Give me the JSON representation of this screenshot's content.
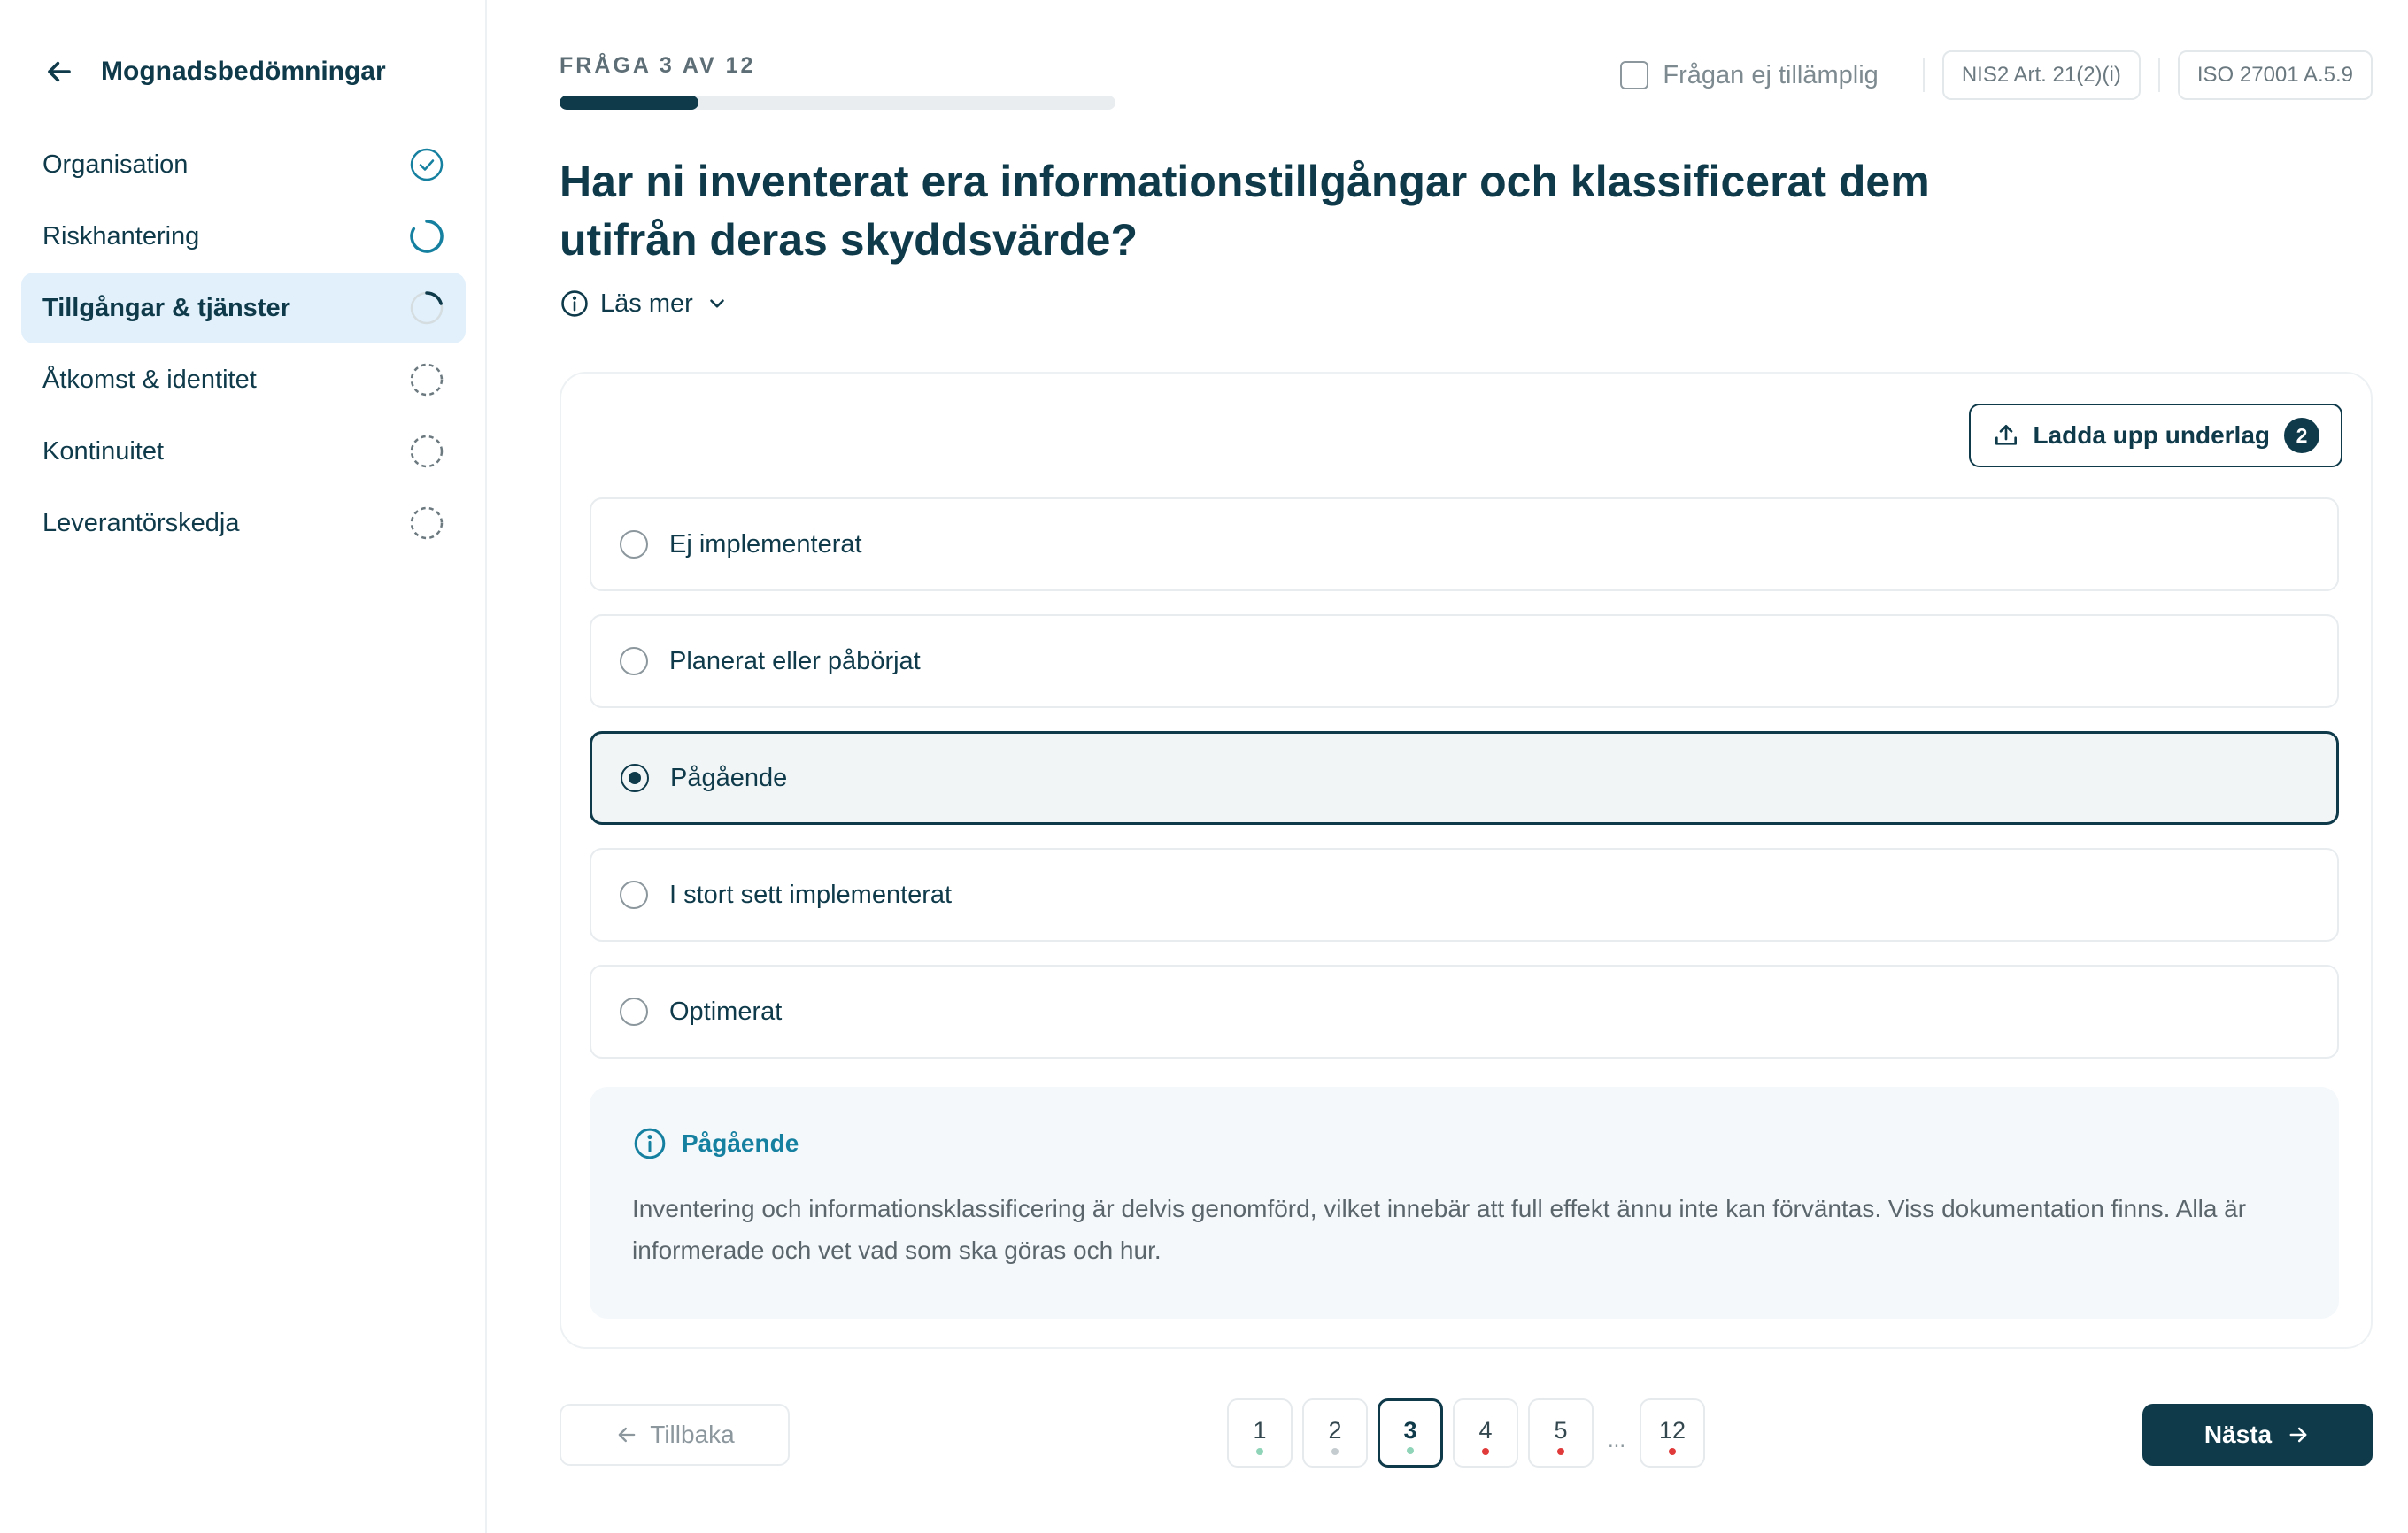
{
  "colors": {
    "primary": "#0e3a4a",
    "accent": "#1680a0",
    "active_bg": "#e1f0fb",
    "dot_done": "#8fd4b8",
    "dot_neutral": "#c5ccd0",
    "dot_missing": "#e03a3a"
  },
  "sidebar": {
    "back_icon": "arrow-left-icon",
    "title": "Mognadsbedömningar",
    "items": [
      {
        "label": "Organisation",
        "status": "complete",
        "icon": "check-circle-icon"
      },
      {
        "label": "Riskhantering",
        "status": "in-progress",
        "icon": "progress-ring-icon"
      },
      {
        "label": "Tillgångar & tjänster",
        "status": "started",
        "icon": "progress-ring-icon",
        "active": true
      },
      {
        "label": "Åtkomst & identitet",
        "status": "not-started",
        "icon": "dashed-circle-icon"
      },
      {
        "label": "Kontinuitet",
        "status": "not-started",
        "icon": "dashed-circle-icon"
      },
      {
        "label": "Leverantörskedja",
        "status": "not-started",
        "icon": "dashed-circle-icon"
      }
    ]
  },
  "header": {
    "counter": "FRÅGA 3 AV 12",
    "progress": 0.25,
    "not_applicable_label": "Frågan ej tillämplig",
    "tags": [
      "NIS2 Art. 21(2)(i)",
      "ISO 27001 A.5.9"
    ]
  },
  "question": {
    "text": "Har ni inventerat era informationstillgångar och klassificerat dem utifrån deras skyddsvärde?",
    "read_more": "Läs mer"
  },
  "upload": {
    "label": "Ladda upp underlag",
    "count": "2"
  },
  "options": [
    {
      "label": "Ej implementerat",
      "selected": false
    },
    {
      "label": "Planerat eller påbörjat",
      "selected": false
    },
    {
      "label": "Pågående",
      "selected": true
    },
    {
      "label": "I stort sett implementerat",
      "selected": false
    },
    {
      "label": "Optimerat",
      "selected": false
    }
  ],
  "info": {
    "title": "Pågående",
    "text": "Inventering och informationsklassificering är delvis genomförd, vilket innebär att full effekt ännu inte kan förväntas. Viss dokumentation finns. Alla är informerade och vet vad som ska göras och hur."
  },
  "footer": {
    "back_label": "Tillbaka",
    "next_label": "Nästa",
    "pages": [
      {
        "num": "1",
        "state": "done"
      },
      {
        "num": "2",
        "state": "neutral"
      },
      {
        "num": "3",
        "state": "done",
        "current": true
      },
      {
        "num": "4",
        "state": "missing"
      },
      {
        "num": "5",
        "state": "missing"
      },
      {
        "num": "12",
        "state": "missing"
      }
    ],
    "ellipsis": "..."
  }
}
